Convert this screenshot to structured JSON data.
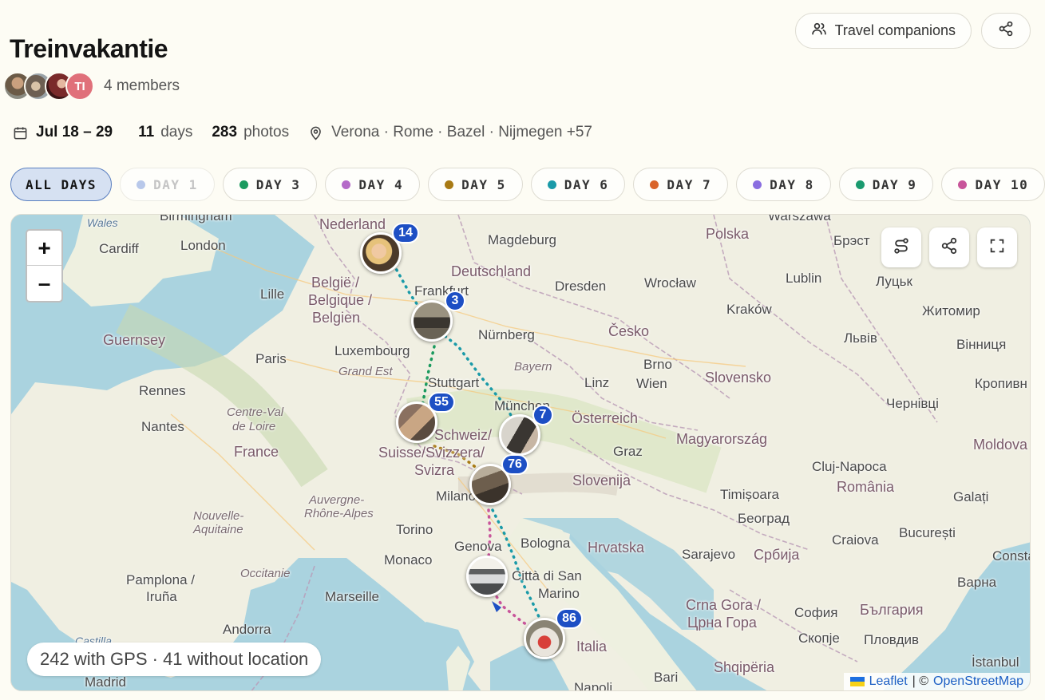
{
  "header": {
    "title": "Treinvakantie",
    "members_label": "4 members",
    "avatar_initials": "TI",
    "travel_companions_label": "Travel companions"
  },
  "meta": {
    "dates": "Jul 18 – 29",
    "days_count": "11",
    "days_label": "days",
    "photos_count": "283",
    "photos_label": "photos",
    "places": "Verona · Rome · Bazel · Nijmegen +57"
  },
  "day_filters": [
    {
      "label": "ALL DAYS",
      "state": "active",
      "color": ""
    },
    {
      "label": "DAY 1",
      "state": "disabled",
      "color": "#b8c8ea"
    },
    {
      "label": "DAY 3",
      "state": "normal",
      "color": "#1a9a5e"
    },
    {
      "label": "DAY 4",
      "state": "normal",
      "color": "#b46ac8"
    },
    {
      "label": "DAY 5",
      "state": "normal",
      "color": "#a87a14"
    },
    {
      "label": "DAY 6",
      "state": "normal",
      "color": "#1a9aa8"
    },
    {
      "label": "DAY 7",
      "state": "normal",
      "color": "#d9642a"
    },
    {
      "label": "DAY 8",
      "state": "normal",
      "color": "#8a6ee0"
    },
    {
      "label": "DAY 9",
      "state": "normal",
      "color": "#1a9a6e"
    },
    {
      "label": "DAY 10",
      "state": "normal",
      "color": "#c8559a"
    }
  ],
  "map": {
    "labels": {
      "wales": "Wales",
      "birmingham": "Birmingham",
      "cardiff": "Cardiff",
      "london": "London",
      "nederland": "Nederland",
      "magdeburg": "Magdeburg",
      "polska": "Polska",
      "warszawa": "Warszawa",
      "brest": "Брэст",
      "deutschland": "Deutschland",
      "dresden": "Dresden",
      "wroclaw": "Wrocław",
      "lublin": "Lublin",
      "lutsk": "Луцьк",
      "belgie": "België /",
      "belgique": "Belgique /",
      "belgien": "Belgien",
      "lille": "Lille",
      "frankfurt": "Frankfurt",
      "krakow": "Kraków",
      "zhytomyr": "Житомир",
      "guernsey": "Guernsey",
      "nurnberg": "Nürnberg",
      "cesko": "Česko",
      "lviv": "Львів",
      "vinnytsia": "Вінниця",
      "paris": "Paris",
      "luxembourg": "Luxembourg",
      "grandest": "Grand Est",
      "bayern": "Bayern",
      "brno": "Brno",
      "rennes": "Rennes",
      "stuttgart": "Stuttgart",
      "linz": "Linz",
      "wien": "Wien",
      "slovensko": "Slovensko",
      "kropyvnytskyi": "Кропивн",
      "centreval": "Centre-Val",
      "deloire": "de Loire",
      "munchen": "München",
      "osterreich": "Österreich",
      "chernivtsi": "Чернівці",
      "nantes": "Nantes",
      "schweiz": "Schweiz/",
      "suisse": "Suisse/Svizzera/",
      "svizra": "Svizra",
      "magyarorszag": "Magyarország",
      "moldova": "Moldova",
      "france": "France",
      "graz": "Graz",
      "clujnapoca": "Cluj-Napoca",
      "slovenija": "Slovenija",
      "romania": "România",
      "auvergne": "Auvergne-",
      "rhonealpes": "Rhône-Alpes",
      "milano": "Milano",
      "timisoara": "Timișoara",
      "galati": "Galați",
      "nouvelle": "Nouvelle-",
      "aquitaine": "Aquitaine",
      "beograd": "Београд",
      "torino": "Torino",
      "bologna": "Bologna",
      "hrvatska": "Hrvatska",
      "craiova": "Craiova",
      "bucuresti": "București",
      "genova": "Genova",
      "sarajevo": "Sarajevo",
      "srbija": "Србија",
      "constanta": "Consta",
      "monaco": "Monaco",
      "occitanie": "Occitanie",
      "cittadisan": "Città di San",
      "marino": "Marino",
      "pamplona": "Pamplona /",
      "iruna": "Iruña",
      "marseille": "Marseille",
      "varna": "Варна",
      "crnagora": "Crna Gora /",
      "tsrnagora": "Црна Гора",
      "sofia": "София",
      "bulgaria": "България",
      "andorra": "Andorra",
      "skopje": "Скопје",
      "plovdiv": "Пловдив",
      "italia": "Italia",
      "castilla": "Castilla",
      "shqiperia": "Shqipëria",
      "istanbul": "İstanbul",
      "madrid": "Madrid",
      "bari": "Bari",
      "napoli": "Napoli"
    },
    "clusters": [
      {
        "count": "14"
      },
      {
        "count": "3"
      },
      {
        "count": "55"
      },
      {
        "count": "7"
      },
      {
        "count": "76"
      },
      {
        "count": "86"
      }
    ],
    "gps_summary": "242 with GPS · 41 without location",
    "attribution_leaflet": "Leaflet",
    "attribution_sep": "| ©",
    "attribution_osm": "OpenStreetMap",
    "zoom_in": "+",
    "zoom_out": "–"
  }
}
